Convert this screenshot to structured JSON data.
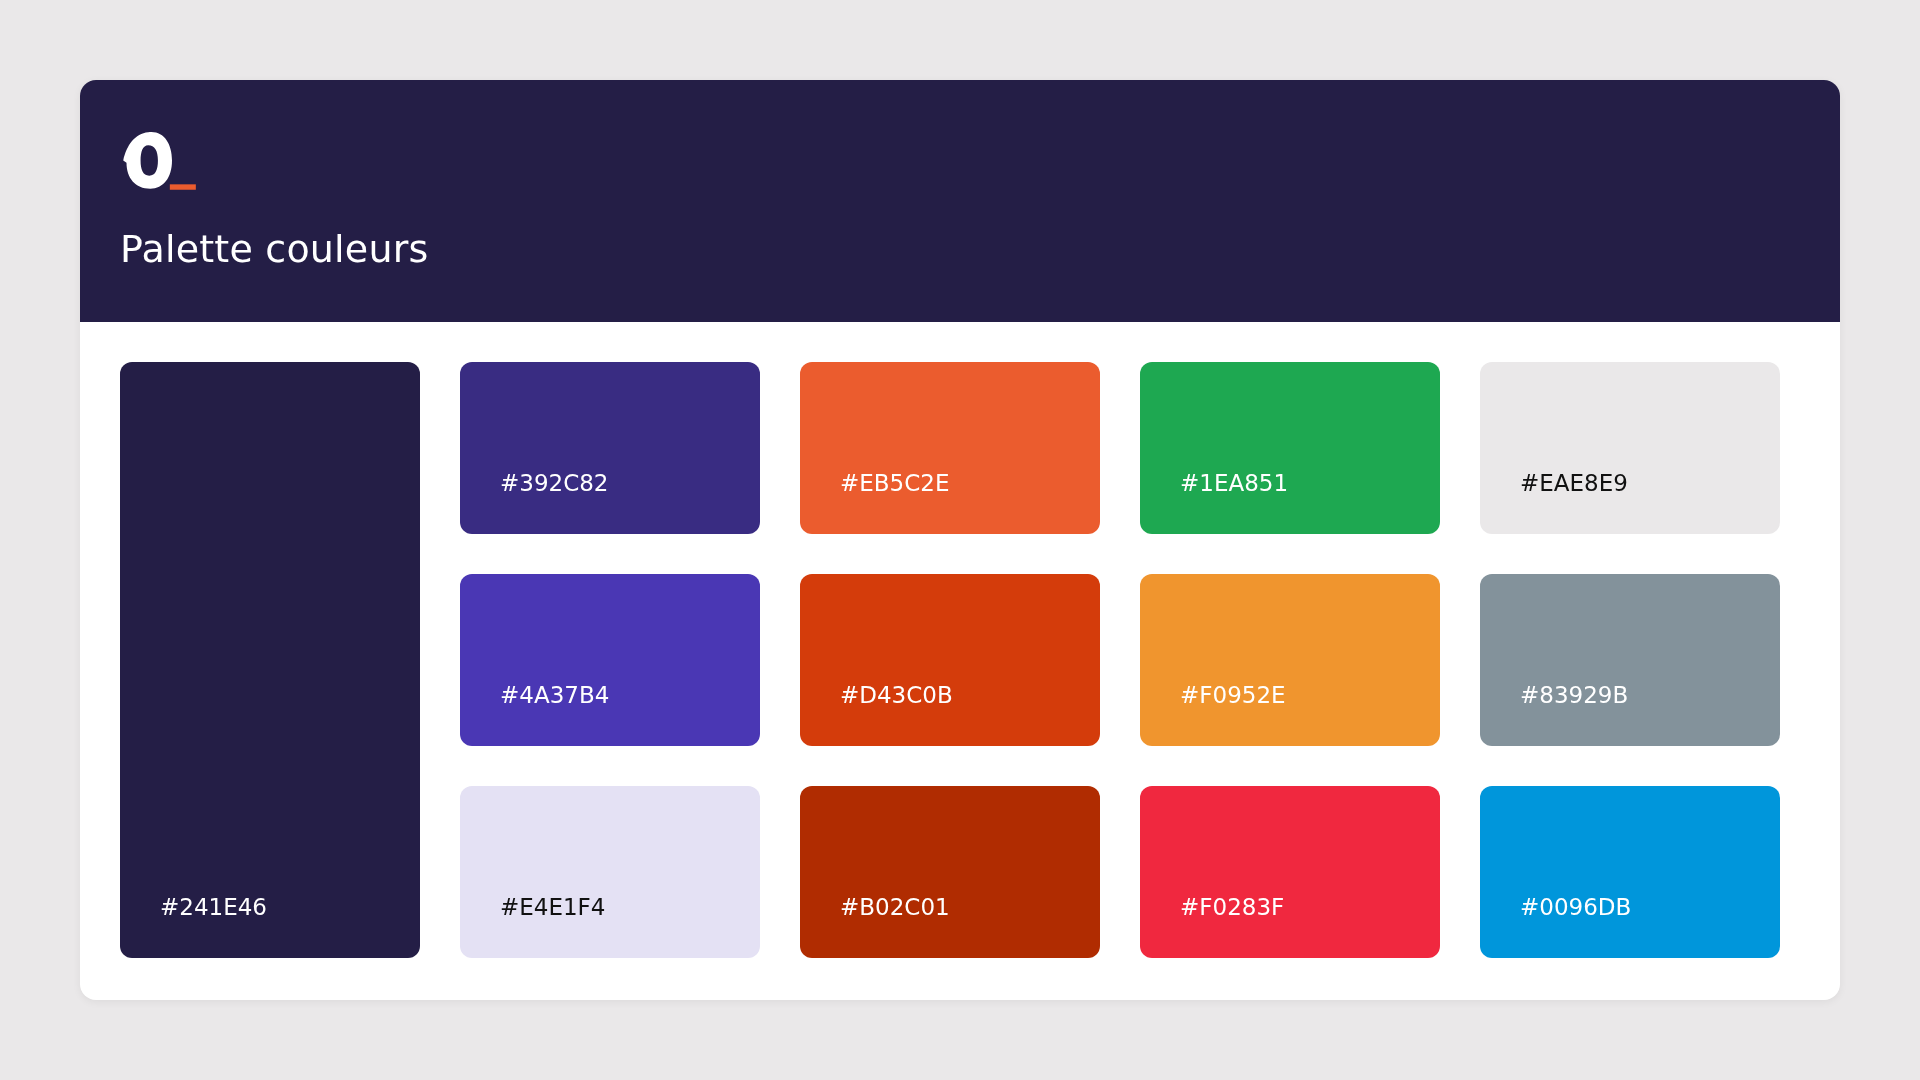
{
  "header": {
    "title": "Palette couleurs"
  },
  "primary_swatch": {
    "label": "#241E46",
    "color": "#241e46"
  },
  "swatches": [
    {
      "label": "#392C82",
      "color": "#392c82"
    },
    {
      "label": "#EB5C2E",
      "color": "#eb5c2e"
    },
    {
      "label": "#1EA851",
      "color": "#1ea851"
    },
    {
      "label": "#EAE8E9",
      "color": "#eae8e9"
    },
    {
      "label": "#4A37B4",
      "color": "#4a37b4"
    },
    {
      "label": "#D43C0B",
      "color": "#d43c0b"
    },
    {
      "label": "#F0952E",
      "color": "#f0952e"
    },
    {
      "label": "#83929B",
      "color": "#83929b"
    },
    {
      "label": "#E4E1F4",
      "color": "#e4e1f4"
    },
    {
      "label": "#B02C01",
      "color": "#b02c01"
    },
    {
      "label": "#F0283F",
      "color": "#f0283f"
    },
    {
      "label": "#0096DB",
      "color": "#0096db"
    }
  ]
}
